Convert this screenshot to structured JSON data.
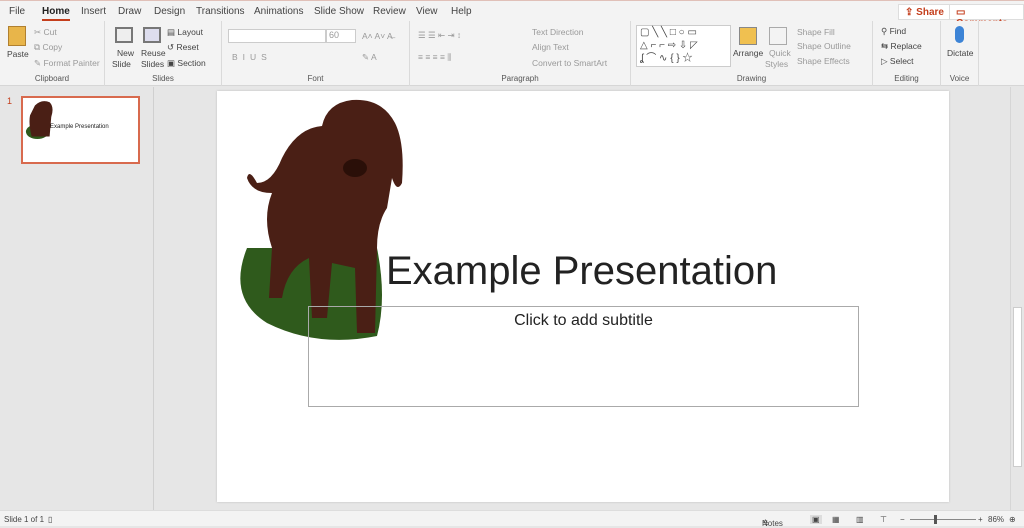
{
  "tabs": [
    "File",
    "Home",
    "Insert",
    "Draw",
    "Design",
    "Transitions",
    "Animations",
    "Slide Show",
    "Review",
    "View",
    "Help"
  ],
  "active_tab": "Home",
  "share_label": "Share",
  "comments_label": "Comments",
  "clipboard": {
    "paste": "Paste",
    "cut": "Cut",
    "copy": "Copy",
    "format_painter": "Format Painter",
    "label": "Clipboard"
  },
  "slides_grp": {
    "new_slide": "New",
    "new_slide2": "Slide",
    "reuse": "Reuse",
    "reuse2": "Slides",
    "layout": "Layout",
    "reset": "Reset",
    "section": "Section",
    "label": "Slides"
  },
  "font": {
    "font_name": "",
    "font_size": "60",
    "label": "Font"
  },
  "paragraph": {
    "text_direction": "Text Direction",
    "align_text": "Align Text",
    "smartart": "Convert to SmartArt",
    "label": "Paragraph"
  },
  "drawing": {
    "arrange": "Arrange",
    "quick": "Quick",
    "styles": "Styles",
    "shape_fill": "Shape Fill",
    "shape_outline": "Shape Outline",
    "shape_effects": "Shape Effects",
    "label": "Drawing"
  },
  "editing": {
    "find": "Find",
    "replace": "Replace",
    "select": "Select",
    "label": "Editing"
  },
  "voice": {
    "dictate": "Dictate",
    "label": "Voice"
  },
  "thumbnail": {
    "number": "1",
    "title": "Example Presentation"
  },
  "slide": {
    "title": "Example Presentation",
    "subtitle_placeholder": "Click to add subtitle"
  },
  "status": {
    "slide_info": "Slide 1 of 1",
    "notes": "Notes",
    "zoom": "86%",
    "zoom_percent": 86
  },
  "colors": {
    "accent": "#c43e1c",
    "dog": "#4a1f15",
    "grass": "#2f5a1c"
  }
}
